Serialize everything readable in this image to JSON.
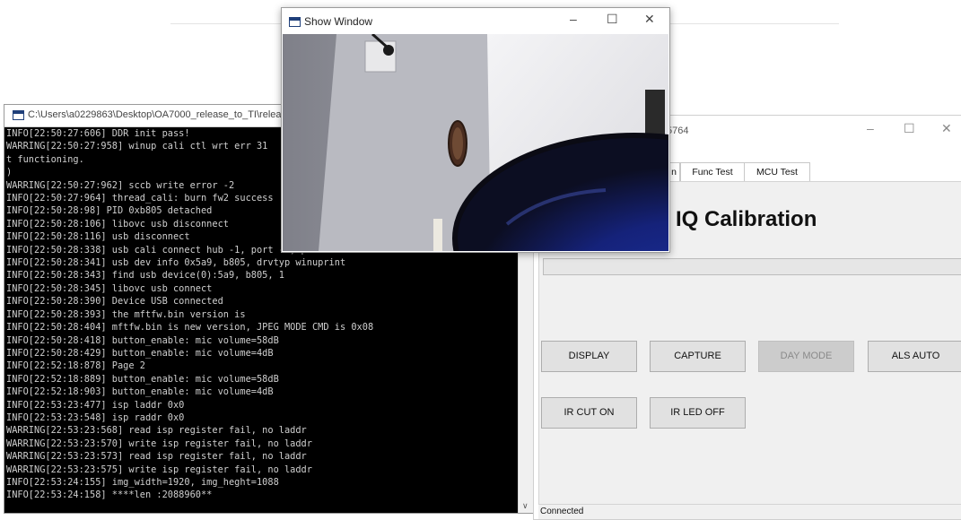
{
  "console": {
    "title": "C:\\Users\\a0229863\\Desktop\\OA7000_release_to_TI\\release\\",
    "lines": [
      "INFO[22:50:27:606] DDR init pass!",
      "WARRING[22:50:27:958] winup cali ctl wrt err 31",
      "t functioning.",
      ")",
      "WARRING[22:50:27:962] sccb write error -2",
      "INFO[22:50:27:964] thread_cali: burn fw2 success",
      "INFO[22:50:28:98] PID 0xb805 detached",
      "INFO[22:50:28:106] libovc usb disconnect",
      "INFO[22:50:28:116] usb disconnect",
      "INFO[22:50:28:338] usb cali connect hub -1, port -1, pid 0xb805",
      "INFO[22:50:28:341] usb dev info 0x5a9, b805, drvtyp winuprint",
      "INFO[22:50:28:343] find usb device(0):5a9, b805, 1",
      "INFO[22:50:28:345] libovc usb connect",
      "INFO[22:50:28:390] Device USB connected",
      "INFO[22:50:28:393] the mftfw.bin version is",
      "INFO[22:50:28:404] mftfw.bin is new version, JPEG MODE CMD is 0x08",
      "INFO[22:50:28:418] button_enable: mic volume=58dB",
      "INFO[22:50:28:429] button_enable: mic volume=4dB",
      "INFO[22:52:18:878] Page 2",
      "INFO[22:52:18:889] button_enable: mic volume=58dB",
      "INFO[22:52:18:903] button_enable: mic volume=4dB",
      "INFO[22:53:23:477] isp laddr 0x0",
      "INFO[22:53:23:548] isp raddr 0x0",
      "WARRING[22:53:23:568] read isp register fail, no laddr",
      "WARRING[22:53:23:570] write isp register fail, no laddr",
      "WARRING[22:53:23:573] read isp register fail, no laddr",
      "WARRING[22:53:23:575] write isp register fail, no laddr",
      "INFO[22:53:24:155] img_width=1920, img_heght=1088",
      "INFO[22:53:24:158] ****len :2088960**"
    ]
  },
  "app": {
    "title": "5764",
    "tabs": [
      "n",
      "Func Test",
      "MCU Test"
    ],
    "heading": "IQ Calibration",
    "buttons": {
      "display": "DISPLAY",
      "capture": "CAPTURE",
      "day_mode": "DAY MODE",
      "als_auto": "ALS AUTO",
      "ir_cut_on": "IR CUT ON",
      "ir_led_off": "IR LED OFF"
    },
    "status": "Connected"
  },
  "show_window": {
    "title": "Show Window"
  },
  "icons": {
    "minimize": "minimize-icon",
    "maximize": "maximize-icon",
    "close": "close-icon"
  }
}
